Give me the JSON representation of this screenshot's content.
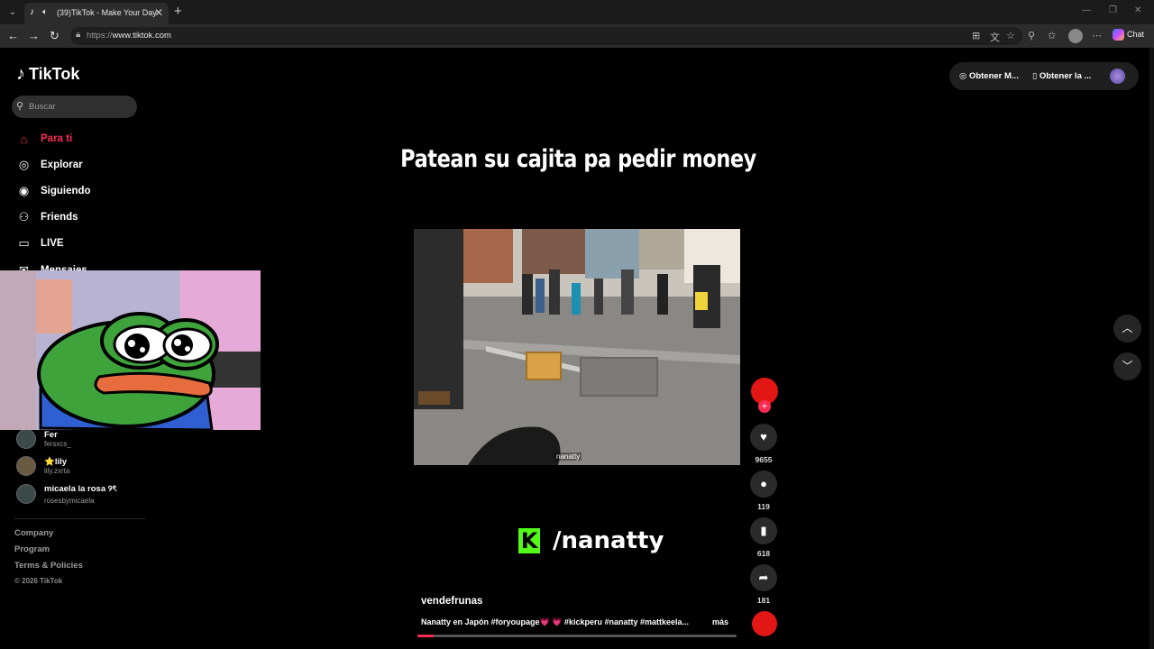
{
  "browser": {
    "tab_title": "(39)TikTok - Make Your Day",
    "url_prefix": "https://",
    "url_domain": "www.tiktok.com",
    "chat_label": "Chat"
  },
  "tiktok": {
    "logo_text": "TikTok",
    "search_placeholder": "Buscar",
    "nav": [
      {
        "label": "Para ti",
        "icon": "home-icon"
      },
      {
        "label": "Explorar",
        "icon": "compass-icon"
      },
      {
        "label": "Siguiendo",
        "icon": "following-icon"
      },
      {
        "label": "Friends",
        "icon": "friends-icon"
      },
      {
        "label": "LIVE",
        "icon": "live-icon"
      },
      {
        "label": "Mensajes",
        "icon": "messages-icon"
      }
    ],
    "following": [
      {
        "name": "Fer",
        "handle": "fersxcs_"
      },
      {
        "name": "⭐lily",
        "handle": "lily.zxrta"
      },
      {
        "name": "micaela la rosa ୨ৎ",
        "handle": "rosesbymicaela"
      }
    ],
    "footer": [
      "Company",
      "Program",
      "Terms & Policies"
    ],
    "copyright": "© 2026 TikTok",
    "top_buttons": [
      "Obtener M...",
      "Obtener la ..."
    ]
  },
  "video": {
    "title_overlay": "Patean su cajita pa pedir money",
    "watermark": "nanatty",
    "kick_handle": "/nanatty",
    "author": "vendefrunas",
    "caption": "Nanatty en Japón #foryoupage💗 💗 #kickperu #nanatty #mattkeela...",
    "more_label": "más",
    "progress_pct": 5,
    "likes": "9655",
    "comments": "119",
    "saves": "618",
    "shares": "181"
  },
  "colors": {
    "accent": "#fe2c55",
    "kick_green": "#53fc18",
    "background": "#000000"
  }
}
